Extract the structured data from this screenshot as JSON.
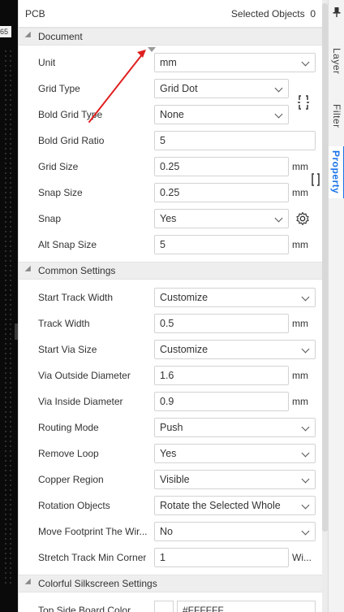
{
  "ruler": {
    "label": "65"
  },
  "panel": {
    "title": "PCB",
    "selected_label": "Selected Objects",
    "selected_count": "0"
  },
  "sections": {
    "document": "Document",
    "common": "Common Settings",
    "silkscreen": "Colorful Silkscreen Settings"
  },
  "document": {
    "unit": {
      "label": "Unit",
      "value": "mm"
    },
    "grid_type": {
      "label": "Grid Type",
      "value": "Grid Dot"
    },
    "bold_grid_type": {
      "label": "Bold Grid Type",
      "value": "None"
    },
    "bold_grid_ratio": {
      "label": "Bold Grid Ratio",
      "value": "5"
    },
    "grid_size": {
      "label": "Grid Size",
      "value": "0.25",
      "unit": "mm"
    },
    "snap_size": {
      "label": "Snap Size",
      "value": "0.25",
      "unit": "mm"
    },
    "snap": {
      "label": "Snap",
      "value": "Yes"
    },
    "alt_snap_size": {
      "label": "Alt Snap Size",
      "value": "5",
      "unit": "mm"
    }
  },
  "common": {
    "start_track_width": {
      "label": "Start Track Width",
      "value": "Customize"
    },
    "track_width": {
      "label": "Track Width",
      "value": "0.5",
      "unit": "mm"
    },
    "start_via_size": {
      "label": "Start Via Size",
      "value": "Customize"
    },
    "via_outside": {
      "label": "Via Outside Diameter",
      "value": "1.6",
      "unit": "mm"
    },
    "via_inside": {
      "label": "Via Inside Diameter",
      "value": "0.9",
      "unit": "mm"
    },
    "routing_mode": {
      "label": "Routing Mode",
      "value": "Push"
    },
    "remove_loop": {
      "label": "Remove Loop",
      "value": "Yes"
    },
    "copper_region": {
      "label": "Copper Region",
      "value": "Visible"
    },
    "rotation_objects": {
      "label": "Rotation Objects",
      "value": "Rotate the Selected Whole"
    },
    "move_footprint": {
      "label": "Move Footprint The Wir...",
      "value": "No"
    },
    "stretch_track": {
      "label": "Stretch Track Min Corner",
      "value": "1",
      "unit": "Wi..."
    }
  },
  "silkscreen": {
    "top_side_board_color": {
      "label": "Top Side Board Color",
      "value": "#FFFFFF"
    }
  },
  "tabs": [
    "Layer",
    "Filter",
    "Property"
  ],
  "colors": {
    "accent": "#1a73e8",
    "annotation_arrow": "#e02020"
  },
  "icons": {
    "pin": "pin-icon",
    "grid_toggle": "bracket-icon",
    "snap_settings": "gear-icon",
    "grid_size_side": "bracket-icon"
  }
}
